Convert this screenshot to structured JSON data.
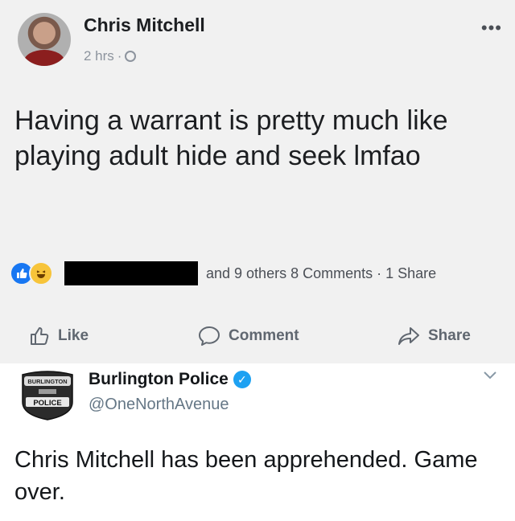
{
  "fb_post": {
    "author": "Chris Mitchell",
    "time": "2 hrs",
    "separator": "·",
    "more_label": "•••",
    "text": "Having a warrant is pretty much like playing adult hide and seek lmfao",
    "reaction_icons": [
      "like-icon",
      "haha-icon"
    ],
    "stats": "and 9 others 8 Comments · 1 Share",
    "actions": {
      "like": "Like",
      "comment": "Comment",
      "share": "Share"
    },
    "colors": {
      "like_blue": "#1877f2",
      "haha_yellow": "#f7c43a",
      "background": "#f1f1f1"
    }
  },
  "tweet": {
    "name": "Burlington Police",
    "handle": "@OneNorthAvenue",
    "text": "Chris Mitchell has been apprehended. Game over.",
    "badge": {
      "top_text": "BURLINGTON",
      "main_text": "POLICE"
    },
    "colors": {
      "verified_blue": "#1da1f2"
    }
  }
}
